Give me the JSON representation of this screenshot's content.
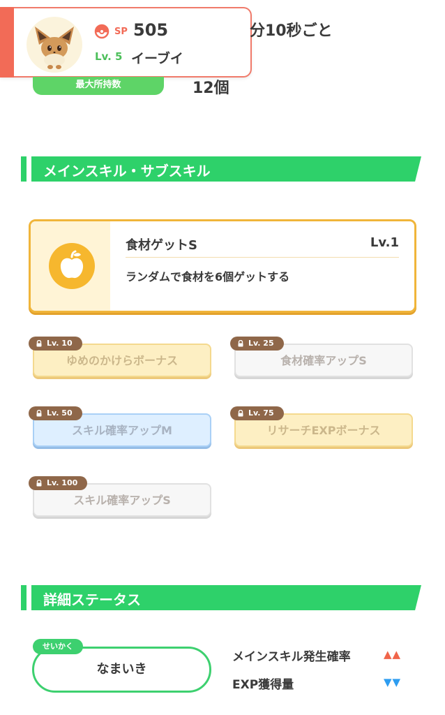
{
  "header": {
    "sp_label": "SP",
    "sp_value": "505",
    "level": "Lv. 5",
    "pokemon_name": "イーブイ",
    "interval_text": "分10秒ごと",
    "carry_label": "最大所持数",
    "carry_value": "12個"
  },
  "sections": {
    "skills_title": "メインスキル・サブスキル",
    "details_title": "詳細ステータス"
  },
  "main_skill": {
    "name": "食材ゲットS",
    "level": "Lv.1",
    "description": "ランダムで食材を6個ゲットする",
    "icon": "apple-icon"
  },
  "sub_skills": [
    {
      "unlock_level": "Lv. 10",
      "name": "ゆめのかけらボーナス",
      "rarity": "gold"
    },
    {
      "unlock_level": "Lv. 25",
      "name": "食材確率アップS",
      "rarity": "white"
    },
    {
      "unlock_level": "Lv. 50",
      "name": "スキル確率アップM",
      "rarity": "blue"
    },
    {
      "unlock_level": "Lv. 75",
      "name": "リサーチEXPボーナス",
      "rarity": "gold"
    },
    {
      "unlock_level": "Lv. 100",
      "name": "スキル確率アップS",
      "rarity": "white"
    }
  ],
  "nature": {
    "tag": "せいかく",
    "value": "なまいき",
    "up_label": "メインスキル発生確率",
    "up_arrows": "▲▲",
    "down_label": "EXP獲得量",
    "down_arrows": "▼▼"
  },
  "colors": {
    "accent_green": "#2ed16a",
    "accent_red": "#f26b57",
    "skill_gold": "#f0b53a",
    "lock_brown": "#8f6749"
  }
}
